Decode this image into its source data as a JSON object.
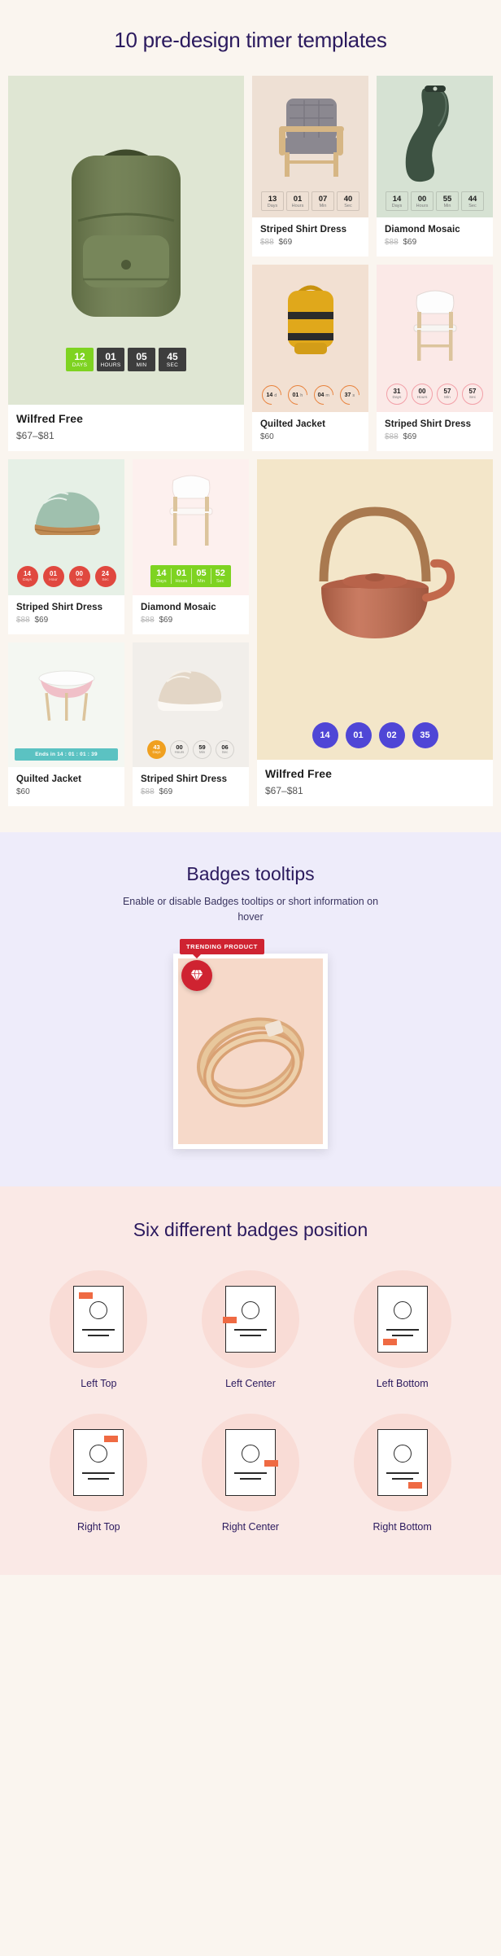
{
  "templates": {
    "title": "10 pre-design timer templates",
    "cards": [
      {
        "id": "wilfred-free-backpack",
        "name": "Wilfred Free",
        "price": "$67–$81",
        "old_price": "",
        "timer_style": "dark-blocks",
        "accent": "#7ed321",
        "bg": "#dfe6d3",
        "timer": [
          {
            "num": "12",
            "label": "DAYS"
          },
          {
            "num": "01",
            "label": "HOURS"
          },
          {
            "num": "05",
            "label": "MIN"
          },
          {
            "num": "45",
            "label": "SEC"
          }
        ]
      },
      {
        "id": "striped-shirt-dress-chair",
        "name": "Striped Shirt Dress",
        "price": "$69",
        "old_price": "$88",
        "timer_style": "light-boxes",
        "accent": "#1d1d1d",
        "bg": "#eee0d4",
        "timer": [
          {
            "num": "13",
            "label": "Days"
          },
          {
            "num": "01",
            "label": "Hours"
          },
          {
            "num": "07",
            "label": "Min"
          },
          {
            "num": "40",
            "label": "Sec"
          }
        ]
      },
      {
        "id": "diamond-mosaic-device",
        "name": "Diamond Mosaic",
        "price": "$69",
        "old_price": "$88",
        "timer_style": "light-boxes",
        "accent": "#1d1d1d",
        "bg": "#d6e2d3",
        "timer": [
          {
            "num": "14",
            "label": "Days"
          },
          {
            "num": "00",
            "label": "Hours"
          },
          {
            "num": "55",
            "label": "Min"
          },
          {
            "num": "44",
            "label": "Sec"
          }
        ]
      },
      {
        "id": "quilted-jacket-backpack",
        "name": "Quilted Jacket",
        "price": "$60",
        "old_price": "",
        "timer_style": "orange-arcs",
        "accent": "#e8823c",
        "bg": "#f2e0d2",
        "timer": [
          {
            "num": "14",
            "label": "d"
          },
          {
            "num": "01",
            "label": "h"
          },
          {
            "num": "04",
            "label": "m"
          },
          {
            "num": "37",
            "label": "s"
          }
        ]
      },
      {
        "id": "striped-shirt-dress-whitechair",
        "name": "Striped Shirt Dress",
        "price": "$69",
        "old_price": "$88",
        "timer_style": "pink-circles",
        "accent": "#f2a0a8",
        "bg": "#fbe9e7",
        "timer": [
          {
            "num": "31",
            "label": "Days"
          },
          {
            "num": "00",
            "label": "Hours"
          },
          {
            "num": "57",
            "label": "Min"
          },
          {
            "num": "57",
            "label": "Sec"
          }
        ]
      },
      {
        "id": "striped-shirt-dress-sneaker",
        "name": "Striped Shirt Dress",
        "price": "$69",
        "old_price": "$88",
        "timer_style": "red-circles",
        "accent": "#e0483f",
        "bg": "#e6f0e6",
        "timer": [
          {
            "num": "14",
            "label": "Days"
          },
          {
            "num": "01",
            "label": "Hour"
          },
          {
            "num": "00",
            "label": "Min"
          },
          {
            "num": "24",
            "label": "Sec"
          }
        ]
      },
      {
        "id": "diamond-mosaic-chair",
        "name": "Diamond Mosaic",
        "price": "$69",
        "old_price": "$88",
        "timer_style": "green-bar",
        "accent": "#7ed321",
        "bg": "#fdf0ee",
        "timer": [
          {
            "num": "14",
            "label": "Days"
          },
          {
            "num": "01",
            "label": "Hours"
          },
          {
            "num": "05",
            "label": "Min"
          },
          {
            "num": "52",
            "label": "Sec"
          }
        ]
      },
      {
        "id": "quilted-jacket-stool",
        "name": "Quilted Jacket",
        "price": "$60",
        "old_price": "",
        "timer_style": "teal-pill",
        "accent": "#5bc2c2",
        "bg": "#f4f7f2",
        "pill_text": "Ends in 14 : 01 : 01 : 39",
        "timer": []
      },
      {
        "id": "striped-shirt-dress-shoe",
        "name": "Striped Shirt Dress",
        "price": "$69",
        "old_price": "$88",
        "timer_style": "orange-circles",
        "accent": "#f0a020",
        "bg": "#f1eeea",
        "timer": [
          {
            "num": "43",
            "label": "Days"
          },
          {
            "num": "00",
            "label": "Hours"
          },
          {
            "num": "59",
            "label": "Min"
          },
          {
            "num": "06",
            "label": "Sec"
          }
        ]
      },
      {
        "id": "wilfred-free-teapot",
        "name": "Wilfred Free",
        "price": "$67–$81",
        "old_price": "",
        "timer_style": "purple-circles",
        "accent": "#4f46d6",
        "bg": "#f3e6c9",
        "timer": [
          {
            "num": "14",
            "label": ""
          },
          {
            "num": "01",
            "label": ""
          },
          {
            "num": "02",
            "label": ""
          },
          {
            "num": "35",
            "label": ""
          }
        ]
      }
    ]
  },
  "badges": {
    "title": "Badges tooltips",
    "subtitle": "Enable or disable Badges tooltips or short information on hover",
    "tooltip_text": "TRENDING PRODUCT",
    "badge_icon": "diamond-icon",
    "tooltip_color": "#cf2331"
  },
  "positions": {
    "title": "Six different badges position",
    "items": [
      {
        "label": "Left Top",
        "tag": "tag-lt"
      },
      {
        "label": "Left Center",
        "tag": "tag-lc"
      },
      {
        "label": "Left Bottom",
        "tag": "tag-lb"
      },
      {
        "label": "Right Top",
        "tag": "tag-rt"
      },
      {
        "label": "Right Center",
        "tag": "tag-rc"
      },
      {
        "label": "Right Bottom",
        "tag": "tag-rb"
      }
    ]
  }
}
